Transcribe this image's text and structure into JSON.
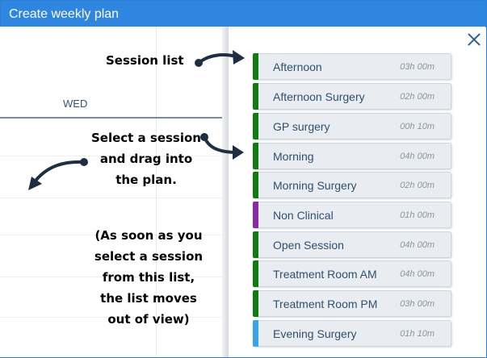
{
  "window": {
    "title": "Create weekly plan"
  },
  "plan": {
    "day_header": "WED"
  },
  "panel": {
    "sessions": [
      {
        "name": "Afternoon",
        "duration": "03h 00m",
        "color": "#0f7c12"
      },
      {
        "name": "Afternoon Surgery",
        "duration": "02h 00m",
        "color": "#0f7c12"
      },
      {
        "name": "GP surgery",
        "duration": "00h 10m",
        "color": "#0f7c12"
      },
      {
        "name": "Morning",
        "duration": "04h 00m",
        "color": "#0f7c12"
      },
      {
        "name": "Morning Surgery",
        "duration": "02h 00m",
        "color": "#0f7c12"
      },
      {
        "name": "Non Clinical",
        "duration": "01h 00m",
        "color": "#8a28a8"
      },
      {
        "name": "Open Session",
        "duration": "04h 00m",
        "color": "#0f7c12"
      },
      {
        "name": "Treatment Room AM",
        "duration": "04h 00m",
        "color": "#0f7c12"
      },
      {
        "name": "Treatment Room PM",
        "duration": "03h 00m",
        "color": "#0f7c12"
      },
      {
        "name": "Evening Surgery",
        "duration": "01h 10m",
        "color": "#3aa5e6"
      }
    ]
  },
  "annotations": {
    "session_list": "Session list",
    "select_lines": [
      "Select a session",
      "and drag into",
      "the plan."
    ],
    "note_lines": [
      "(As soon as you",
      "select a session",
      "from this list,",
      "the list moves",
      "out of view)"
    ]
  },
  "icons": {
    "close": "close-icon"
  }
}
